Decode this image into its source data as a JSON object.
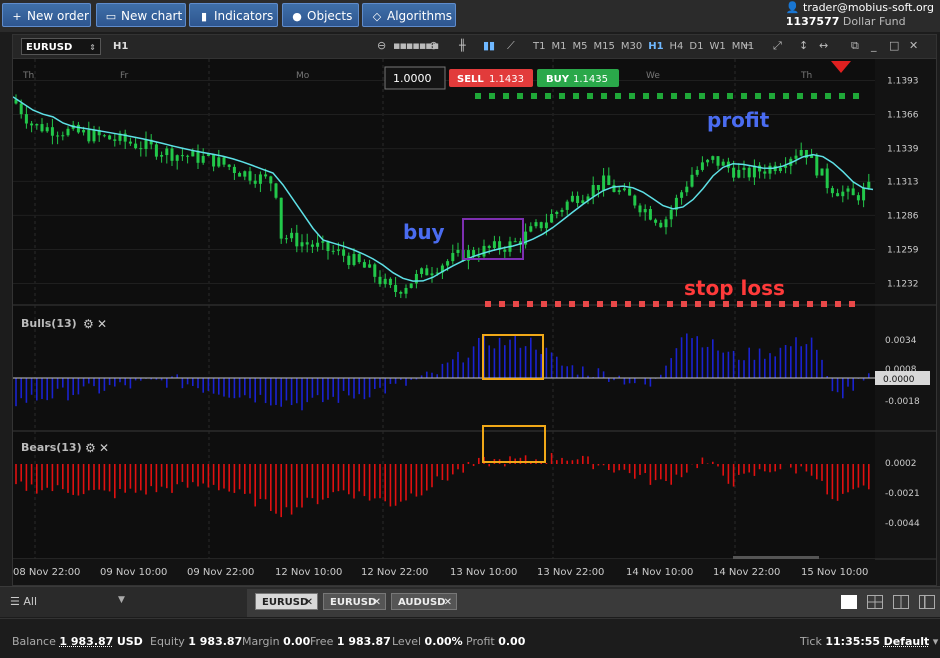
{
  "toolbar": {
    "new_order": "New order",
    "new_chart": "New chart",
    "indicators": "Indicators",
    "objects": "Objects",
    "algorithms": "Algorithms"
  },
  "account": {
    "email": "trader@mobius-soft.org",
    "number": "1137577",
    "fund": "Dollar Fund"
  },
  "chart": {
    "symbol": "EURUSD",
    "timeframe": "H1",
    "timeframes": [
      "T1",
      "M1",
      "M5",
      "M15",
      "M30",
      "H1",
      "H4",
      "D1",
      "W1",
      "MN1"
    ],
    "active_timeframe": "H1",
    "lot": "1.0000",
    "sell_label": "SELL",
    "sell_price": "1.1433",
    "buy_label": "BUY",
    "buy_price": "1.1435",
    "day_labels": [
      {
        "text": "Th",
        "x": 10
      },
      {
        "text": "Fr",
        "x": 107
      },
      {
        "text": "Mo",
        "x": 283
      },
      {
        "text": "We",
        "x": 633
      },
      {
        "text": "Th",
        "x": 788
      }
    ],
    "price_ticks": [
      "1.1393",
      "1.1366",
      "1.1339",
      "1.1313",
      "1.1286",
      "1.1259",
      "1.1232"
    ],
    "price_min": 1.1215,
    "price_max": 1.141,
    "annotations": {
      "profit": "profit",
      "buy": "buy",
      "stop_loss": "stop loss"
    }
  },
  "bulls": {
    "title": "Bulls(13)",
    "ticks": [
      "0.0034",
      "0.0008",
      "-0.0018"
    ],
    "current": "0.0000",
    "colors": {
      "bar": "#1a22d0"
    }
  },
  "bears": {
    "title": "Bears(13)",
    "ticks": [
      "0.0002",
      "-0.0021",
      "-0.0044"
    ],
    "colors": {
      "bar": "#e01010"
    }
  },
  "time_axis": [
    "08 Nov 22:00",
    "09 Nov 10:00",
    "09 Nov 22:00",
    "12 Nov 10:00",
    "12 Nov 22:00",
    "13 Nov 10:00",
    "13 Nov 22:00",
    "14 Nov 10:00",
    "14 Nov 22:00",
    "15 Nov 10:00"
  ],
  "chart_data": {
    "type": "candlestick",
    "symbol": "EURUSD",
    "interval": "H1",
    "ylim": [
      1.1215,
      1.141
    ],
    "ma_color": "#5ee0e6",
    "up_color": "#22c84a",
    "down_color": "#22c84a"
  },
  "bottom": {
    "filter": "All",
    "tabs": [
      {
        "label": "EURUSD",
        "active": true
      },
      {
        "label": "EURUSD",
        "active": false
      },
      {
        "label": "AUDUSD",
        "active": false
      }
    ]
  },
  "status": {
    "balance_label": "Balance",
    "balance": "1 983.87",
    "currency": "USD",
    "equity_label": "Equity",
    "equity": "1 983.87",
    "margin_label": "Margin",
    "margin": "0.00",
    "free_label": "Free",
    "free": "1 983.87",
    "level_label": "Level",
    "level": "0.00%",
    "profit_label": "Profit",
    "profit": "0.00",
    "tick_label": "Tick",
    "tick": "11:35:55",
    "profile": "Default"
  }
}
